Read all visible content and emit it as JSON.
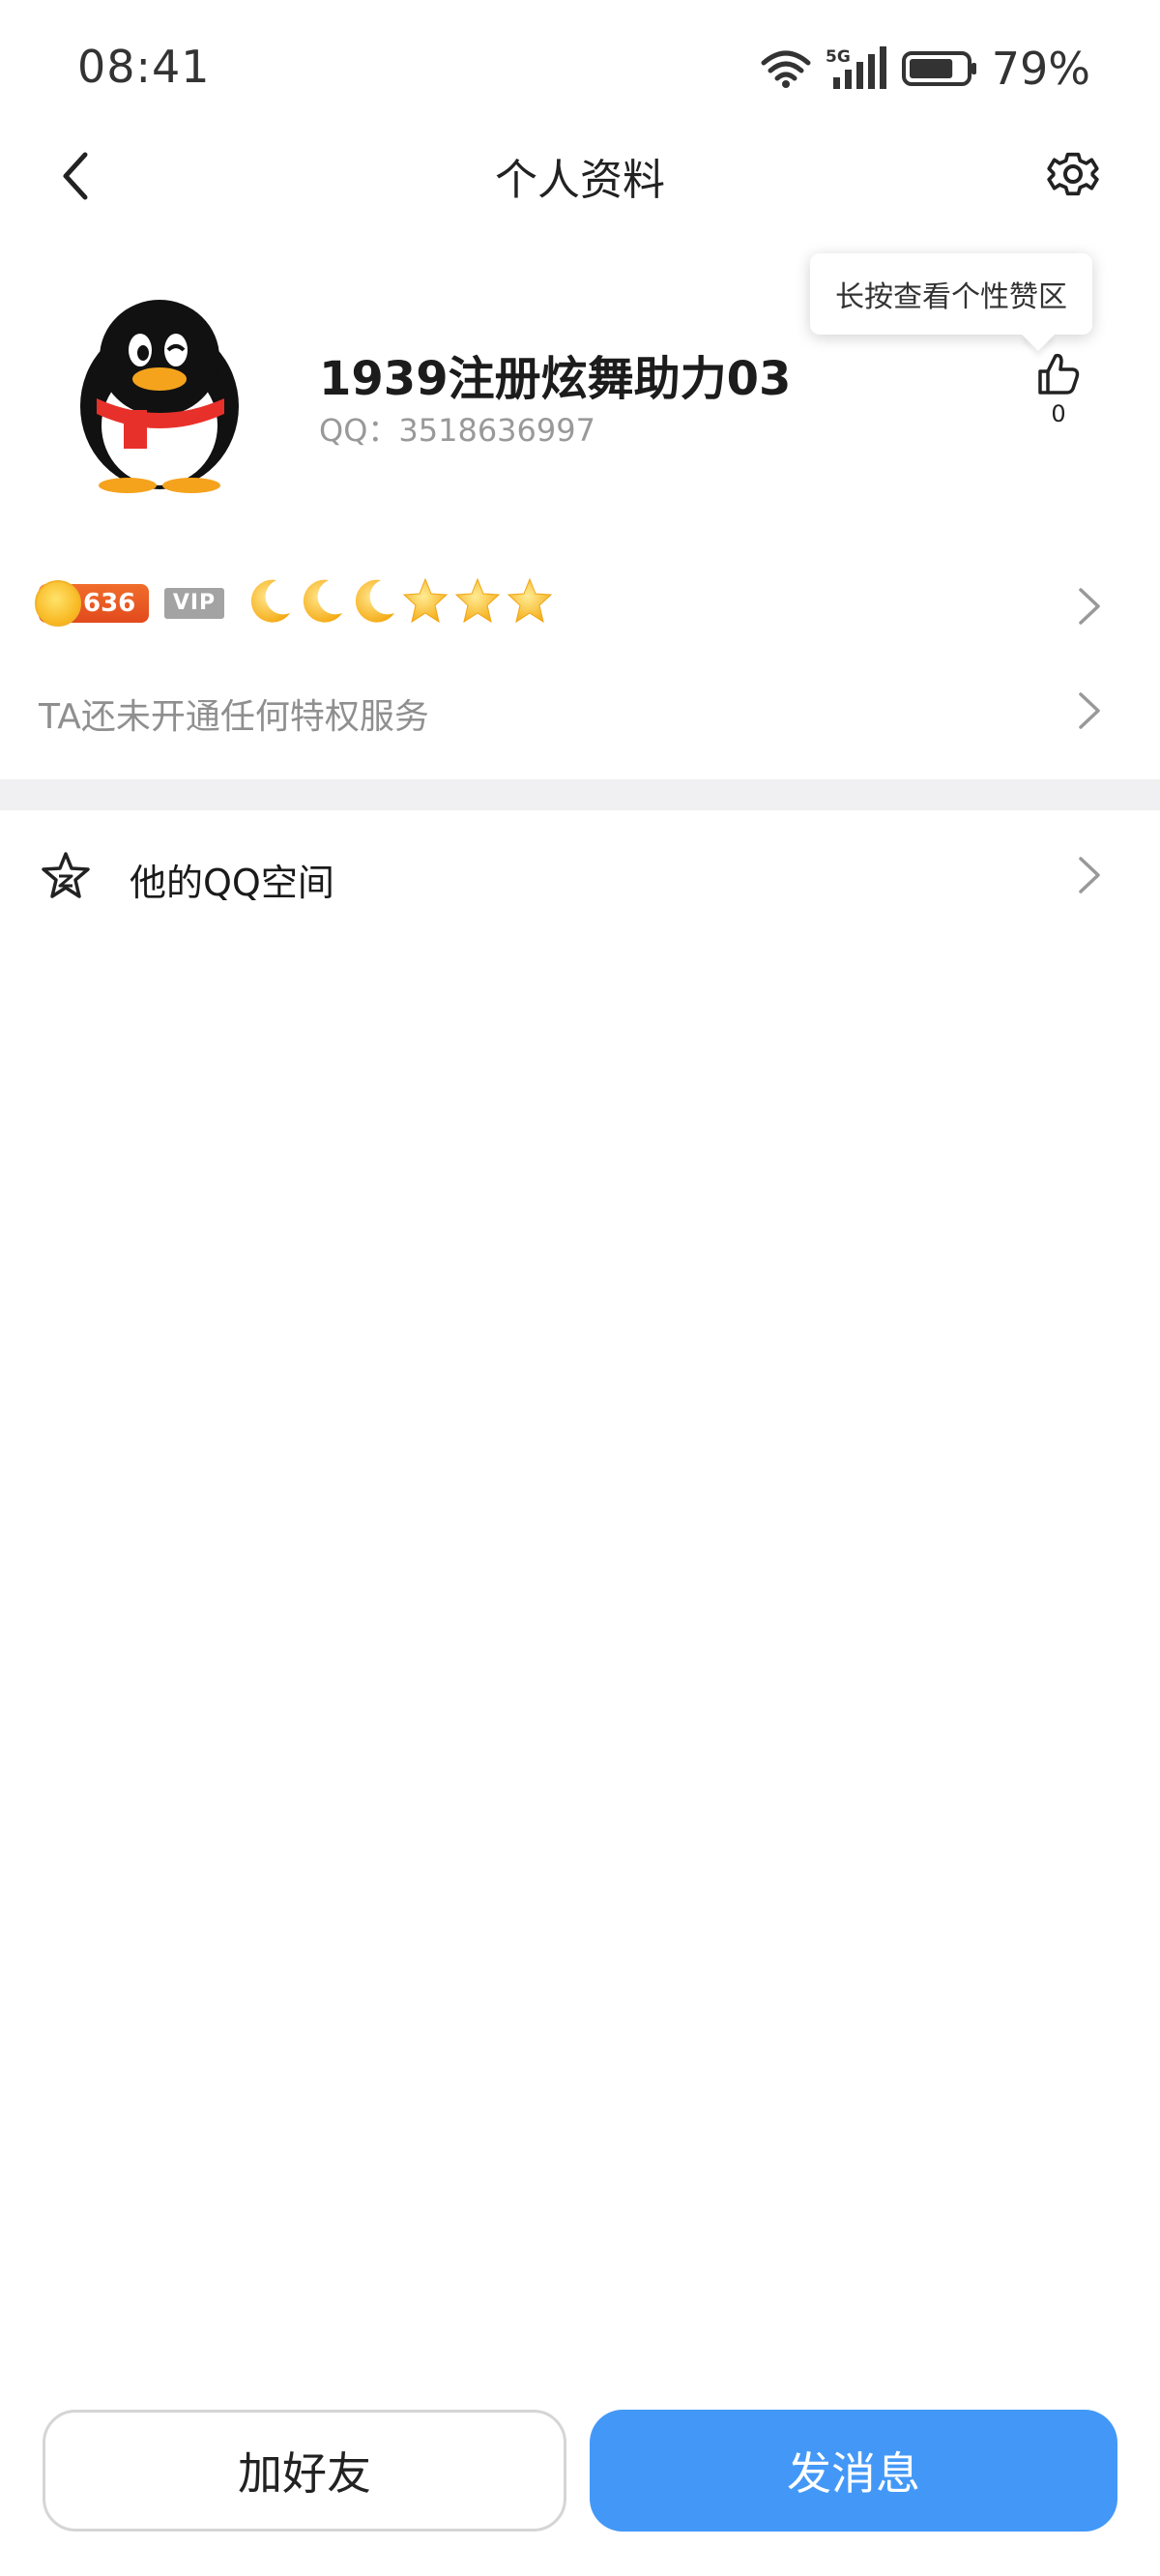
{
  "status_bar": {
    "time": "08:41",
    "network": "5G",
    "battery_percent": "79%",
    "battery_level": 0.79
  },
  "nav": {
    "title": "个人资料",
    "back_icon": "chevron-left-icon",
    "settings_icon": "gear-icon"
  },
  "profile": {
    "nickname": "1939注册炫舞助力03",
    "qq_label": "QQ：3518636997",
    "avatar_icon": "qq-penguin-avatar",
    "tooltip": "长按查看个性赞区",
    "like_count": "0"
  },
  "level_row": {
    "level": "636",
    "vip": "VIP",
    "moons": 3,
    "stars": 3
  },
  "privilege": {
    "text": "TA还未开通任何特权服务"
  },
  "menu": {
    "qzone_label": "他的QQ空间",
    "qzone_icon": "star-outline-icon"
  },
  "actions": {
    "add_friend": "加好友",
    "send_message": "发消息"
  },
  "colors": {
    "primary_button": "#4398f7",
    "level_badge": "#e85a22",
    "vip_badge": "#a3a3a3",
    "divider": "#f0f0f2"
  }
}
